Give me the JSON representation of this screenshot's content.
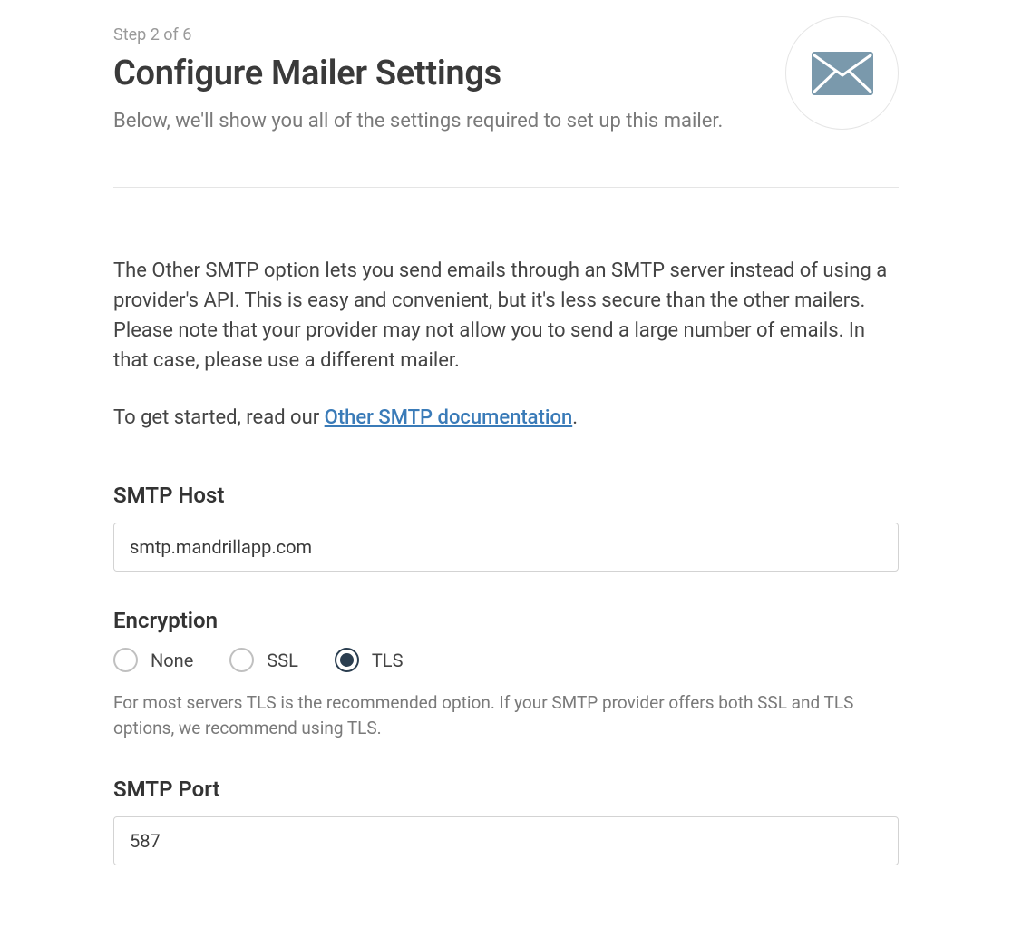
{
  "step": {
    "indicator": "Step 2 of 6"
  },
  "header": {
    "title": "Configure Mailer Settings",
    "subtitle": "Below, we'll show you all of the settings required to set up this mailer."
  },
  "icon": {
    "accent_color": "#7a99ac"
  },
  "intro": {
    "description": "The Other SMTP option lets you send emails through an SMTP server instead of using a provider's API. This is easy and convenient, but it's less secure than the other mailers. Please note that your provider may not allow you to send a large number of emails. In that case, please use a different mailer.",
    "start_prefix": "To get started, read our ",
    "doc_link_text": "Other SMTP documentation",
    "start_suffix": "."
  },
  "fields": {
    "smtp_host": {
      "label": "SMTP Host",
      "value": "smtp.mandrillapp.com"
    },
    "encryption": {
      "label": "Encryption",
      "options": {
        "none": "None",
        "ssl": "SSL",
        "tls": "TLS"
      },
      "selected": "tls",
      "help": "For most servers TLS is the recommended option. If your SMTP provider offers both SSL and TLS options, we recommend using TLS."
    },
    "smtp_port": {
      "label": "SMTP Port",
      "value": "587"
    }
  }
}
